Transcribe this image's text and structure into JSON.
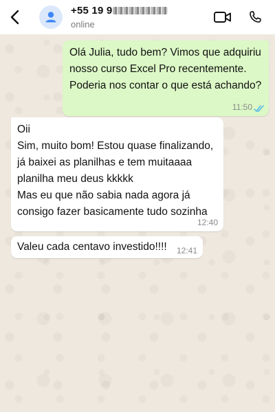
{
  "header": {
    "contact_name": "+55 19 9",
    "contact_status": "online",
    "icons": {
      "back": "back-arrow-icon",
      "avatar": "user-icon",
      "video": "video-camera-icon",
      "call": "phone-icon"
    }
  },
  "messages": [
    {
      "direction": "outgoing",
      "text": "Olá Julia, tudo bem? Vimos que adquiriu nosso curso Excel Pro recentemente. Poderia nos contar o que está achando?",
      "time": "11:50",
      "status": "read"
    },
    {
      "direction": "incoming",
      "text": "Oii\nSim, muito bom! Estou quase finalizando, já baixei as planilhas e tem muitaaaa planilha meu deus kkkkk\nMas eu que não sabia nada agora já consigo fazer basicamente tudo sozinha",
      "time": "12:40"
    },
    {
      "direction": "incoming",
      "text": "Valeu cada centavo investido!!!!",
      "time": "12:41"
    }
  ],
  "colors": {
    "outgoing_bubble": "#dcf8c6",
    "incoming_bubble": "#ffffff",
    "chat_background": "#eee8df",
    "read_ticks": "#4fb6ec",
    "avatar_icon": "#3f87f5"
  }
}
